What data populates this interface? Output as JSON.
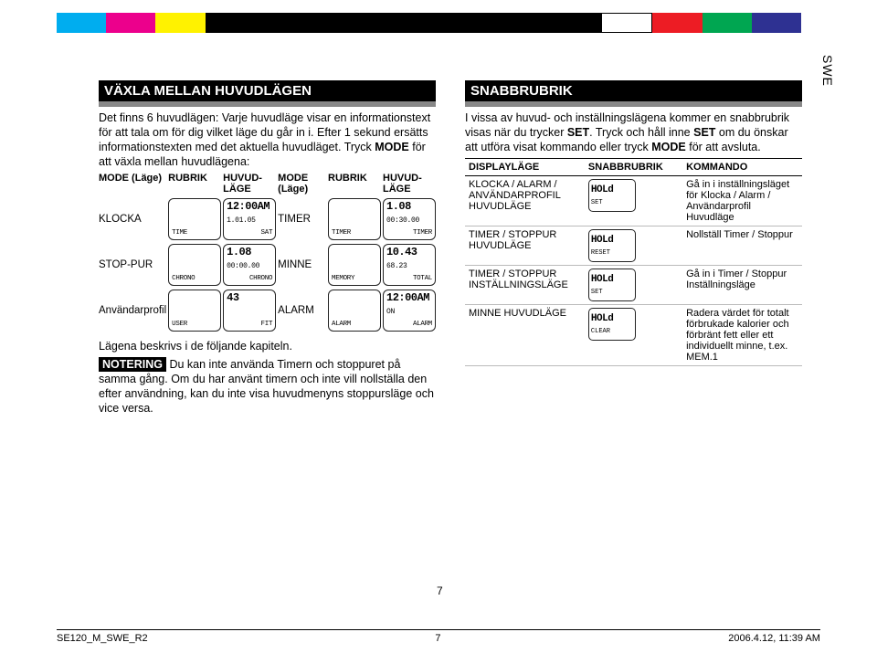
{
  "side_label": "SWE",
  "page_number": "7",
  "footer": {
    "file": "SE120_M_SWE_R2",
    "page": "7",
    "date": "2006.4.12, 11:39 AM"
  },
  "left": {
    "heading": "VÄXLA MELLAN HUVUDLÄGEN",
    "intro1": "Det finns 6 huvudlägen: Varje huvudläge visar en informationstext för att tala om för dig vilket läge du går in i. Efter 1 sekund ersätts informationstexten med det aktuella huvudläget. Tryck ",
    "intro_bold": "MODE",
    "intro2": " för att växla mellan huvudlägena:",
    "th": {
      "mode": "MODE (Läge)",
      "rubrik": "RUBRIK",
      "huvud": "HUVUD-LÄGE"
    },
    "rows": [
      {
        "label_a": "KLOCKA",
        "lcd_a1": {
          "big": "",
          "bot_l": "TIME",
          "bot_r": ""
        },
        "lcd_a2": {
          "big": "12:00AM",
          "mid": "1.01.05",
          "bot_l": "",
          "bot_r": "SAT"
        },
        "label_b": "TIMER",
        "lcd_b1": {
          "big": "",
          "bot_l": "TIMER",
          "bot_r": ""
        },
        "lcd_b2": {
          "big": "1.08",
          "mid": "00:30.00",
          "bot_l": "",
          "bot_r": "TIMER"
        }
      },
      {
        "label_a": "STOP-PUR",
        "lcd_a1": {
          "big": "",
          "bot_l": "CHRONO",
          "bot_r": ""
        },
        "lcd_a2": {
          "big": "1.08",
          "mid": "00:00.00",
          "bot_l": "",
          "bot_r": "CHRONO"
        },
        "label_b": "MINNE",
        "lcd_b1": {
          "big": "",
          "bot_l": "MEMORY",
          "bot_r": ""
        },
        "lcd_b2": {
          "big": "10.43",
          "mid": "68.23",
          "bot_l": "",
          "bot_r": "TOTAL"
        }
      },
      {
        "label_a": "Användarprofil",
        "lcd_a1": {
          "big": "",
          "bot_l": "USER",
          "bot_r": ""
        },
        "lcd_a2": {
          "big": "43",
          "mid": "",
          "bot_l": "",
          "bot_r": "FIT"
        },
        "label_b": "ALARM",
        "lcd_b1": {
          "big": "",
          "bot_l": "ALARM",
          "bot_r": ""
        },
        "lcd_b2": {
          "big": "12:00AM",
          "mid": "ON",
          "bot_l": "",
          "bot_r": "ALARM"
        }
      }
    ],
    "after": "Lägena beskrivs i de följande kapiteln.",
    "note_label": "NOTERING",
    "note_text": " Du kan inte använda Timern och stoppuret på samma gång. Om du har använt timern och inte vill nollställa den efter användning, kan du inte visa huvudmenyns stoppursläge och vice versa."
  },
  "right": {
    "heading": "SNABBRUBRIK",
    "intro1": "I vissa av huvud- och inställningslägena kommer en snabbrubrik visas när du trycker ",
    "bSET": "SET",
    "intro2": ". Tryck och håll inne ",
    "intro3": " om du önskar att utföra visat kommando eller tryck ",
    "bMODE": "MODE",
    "intro4": " för att avsluta.",
    "th": {
      "c1": "DISPLAYLÄGE",
      "c2": "SNABBRUBRIK",
      "c3": "KOMMANDO"
    },
    "rows": [
      {
        "c1": "KLOCKA / ALARM / ANVÄNDARPROFIL HUVUDLÄGE",
        "lcd": {
          "big": "HOLd",
          "bot": "SET"
        },
        "c3": "Gå in i inställningsläget för Klocka / Alarm / Användarprofil Huvudläge"
      },
      {
        "c1": "TIMER / STOPPUR HUVUDLÄGE",
        "lcd": {
          "big": "HOLd",
          "bot": "RESET"
        },
        "c3": "Nollställ Timer / Stoppur"
      },
      {
        "c1": "TIMER / STOPPUR INSTÄLLNINGSLÄGE",
        "lcd": {
          "big": "HOLd",
          "bot": "SET"
        },
        "c3": "Gå in i Timer / Stoppur Inställningsläge"
      },
      {
        "c1": "MINNE HUVUDLÄGE",
        "lcd": {
          "big": "HOLd",
          "bot": "CLEAR"
        },
        "c3": "Radera värdet för totalt förbrukade kalorier och förbränt fett eller ett individuellt minne, t.ex. MEM.1"
      }
    ]
  }
}
